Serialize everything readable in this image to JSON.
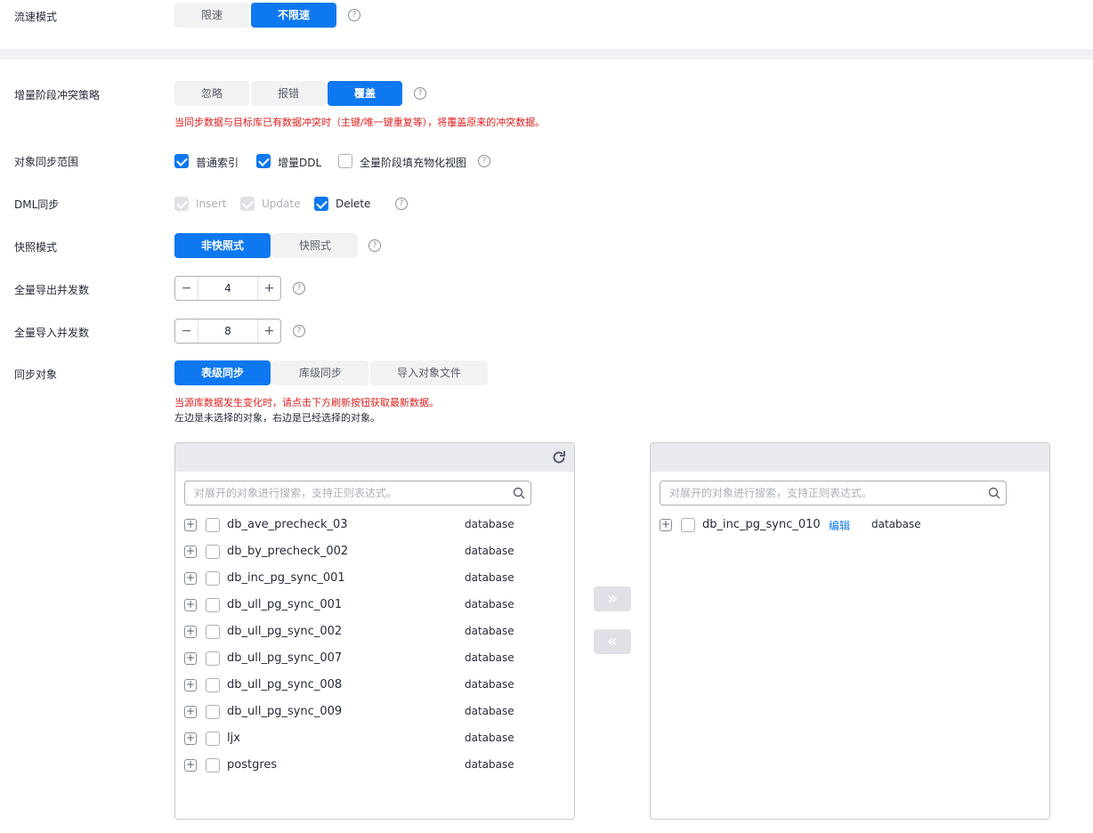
{
  "flow": {
    "label": "流速模式",
    "options": [
      "限速",
      "不限速"
    ],
    "active": 1
  },
  "conflict": {
    "label": "增量阶段冲突策略",
    "options": [
      "忽略",
      "报错",
      "覆盖"
    ],
    "hint": "当同步数据与目标库已有数据冲突时（主键/唯一键重复等），将覆盖原来的冲突数据。"
  },
  "scope": {
    "label": "对象同步范围",
    "items": [
      "普通索引",
      "增量DDL",
      "全量阶段填充物化视图"
    ]
  },
  "dml": {
    "label": "DML同步",
    "items": [
      "Insert",
      "Update",
      "Delete"
    ]
  },
  "snapshot": {
    "label": "快照模式",
    "options": [
      "非快照式",
      "快照式"
    ]
  },
  "export_conc": {
    "label": "全量导出并发数",
    "value": "4"
  },
  "import_conc": {
    "label": "全量导入并发数",
    "value": "8"
  },
  "sync_obj": {
    "label": "同步对象",
    "options": [
      "表级同步",
      "库级同步",
      "导入对象文件"
    ],
    "hint1": "当源库数据发生变化时，请点击下方刷新按钮获取最新数据。",
    "hint2": "左边是未选择的对象，右边是已经选择的对象。"
  },
  "left_panel": {
    "search_placeholder": "对展开的对象进行搜索，支持正则表达式。",
    "rows": [
      {
        "name": "db_ave_precheck_03",
        "type": "database"
      },
      {
        "name": "db_by_precheck_002",
        "type": "database"
      },
      {
        "name": "db_inc_pg_sync_001",
        "type": "database"
      },
      {
        "name": "db_ull_pg_sync_001",
        "type": "database"
      },
      {
        "name": "db_ull_pg_sync_002",
        "type": "database"
      },
      {
        "name": "db_ull_pg_sync_007",
        "type": "database"
      },
      {
        "name": "db_ull_pg_sync_008",
        "type": "database"
      },
      {
        "name": "db_ull_pg_sync_009",
        "type": "database"
      },
      {
        "name": "ljx",
        "type": "database"
      },
      {
        "name": "postgres",
        "type": "database"
      }
    ]
  },
  "right_panel": {
    "search_placeholder": "对展开的对象进行搜索，支持正则表达式。",
    "rows": [
      {
        "name": "db_inc_pg_sync_010",
        "edit": "编辑",
        "type": "database"
      }
    ]
  },
  "icons": {
    "help": "?",
    "expand": "+",
    "minus": "−",
    "plus": "+",
    "move_right": "»",
    "move_left": "«"
  },
  "colors": {
    "primary": "#0e78f0",
    "warning": "#e02020"
  }
}
